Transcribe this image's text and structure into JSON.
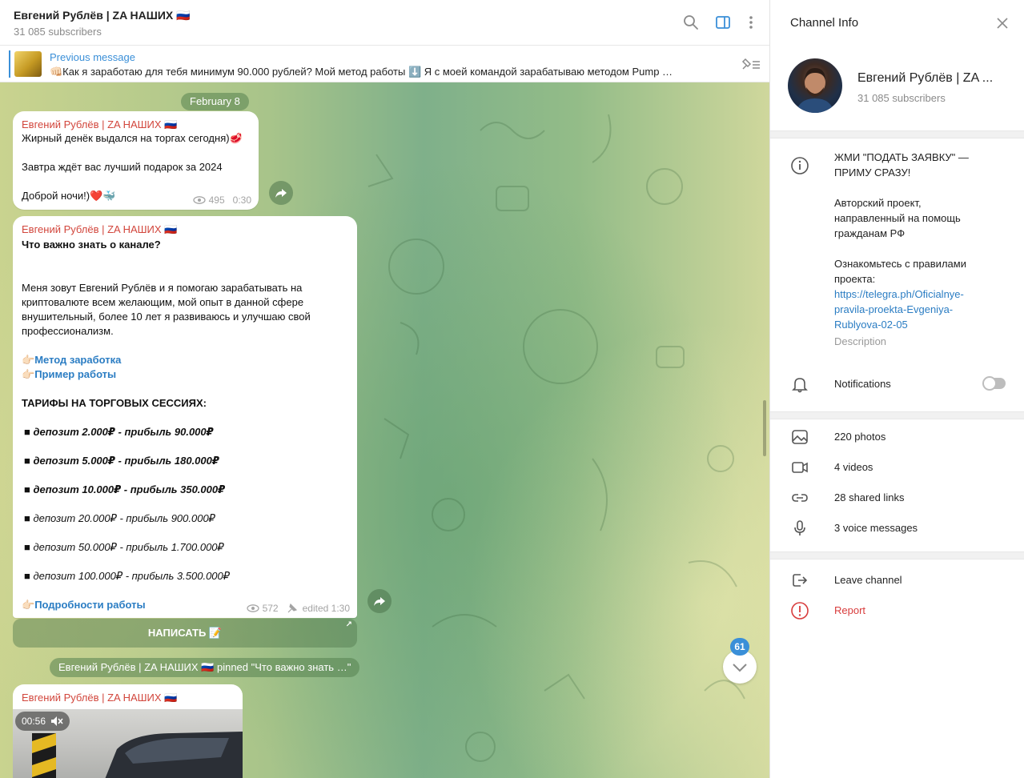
{
  "header": {
    "title": "Евгений Рублёв | ZA НАШИХ 🇷🇺",
    "subtitle": "31 085 subscribers"
  },
  "pinned": {
    "label": "Previous message",
    "text": "👊🏻Как я заработаю для тебя минимум 90.000 рублей? Мой метод работы ⬇️  Я с моей командой зарабатываю методом Pump …"
  },
  "chat": {
    "date": "February 8",
    "msg1": {
      "sender": "Евгений Рублёв | ZA НАШИХ 🇷🇺",
      "line1": "Жирный денёк выдался на торгах сегодня)🥩",
      "line2": "Завтра ждёт вас лучший подарок за 2024",
      "line3": "Доброй ночи!)❤️🐳",
      "views": "495",
      "time": "0:30"
    },
    "msg2": {
      "sender": "Евгений Рублёв | ZA НАШИХ 🇷🇺",
      "heading": "Что важно знать о канале?",
      "para": "Меня зовут Евгений Рублёв и я помогаю зарабатывать на криптовалюте всем желающим, мой опыт в данной сфере внушительный, более 10 лет я развиваюсь и улучшаю свой профессионализм.",
      "link1": "Метод заработка",
      "link2": "Пример работы",
      "link_emoji": "👉🏻",
      "tariffs_title": "ТАРИФЫ НА ТОРГОВЫХ СЕССИЯХ:",
      "tariffs": [
        "депозит 2.000₽ - прибыль 90.000₽",
        "депозит 5.000₽ - прибыль 180.000₽",
        "депозит 10.000₽ - прибыль 350.000₽",
        "депозит 20.000₽ - прибыль 900.000₽",
        "депозит 50.000₽ - прибыль 1.700.000₽",
        "депозит 100.000₽ - прибыль 3.500.000₽"
      ],
      "link3": "Подробности работы",
      "views": "572",
      "edited": "edited 1:30"
    },
    "button": "НАПИСАТЬ 📝",
    "service": "Евгений Рублёв | ZA НАШИХ 🇷🇺 pinned \"Что важно знать …\"",
    "msg3": {
      "sender": "Евгений Рублёв | ZA НАШИХ 🇷🇺",
      "duration": "00:56"
    },
    "unread_count": "61"
  },
  "panel": {
    "title": "Channel Info",
    "name": "Евгений Рублёв | ZA ...",
    "subs": "31 085 subscribers",
    "desc_l1": "ЖМИ \"ПОДАТЬ ЗАЯВКУ\" —",
    "desc_l2": "ПРИМУ СРАЗУ!",
    "desc_l3": "Авторский проект,",
    "desc_l4": "направленный на помощь",
    "desc_l5": "гражданам РФ",
    "desc_l6": "Ознакомьтесь с правилами",
    "desc_l7": "проекта:",
    "desc_link1": "https://telegra.ph/Oficialnye-",
    "desc_link2": "pravila-proekta-Evgeniya-",
    "desc_link3": "Rublyova-02-05",
    "desc_caption": "Description",
    "notifications": "Notifications",
    "photos": "220 photos",
    "videos": "4 videos",
    "links": "28 shared links",
    "voice": "3 voice messages",
    "leave": "Leave channel",
    "report": "Report"
  },
  "colors": {
    "accent": "#3a8fd8",
    "sender": "#d2463c",
    "link": "#2b7dc3",
    "danger": "#d83c3c"
  }
}
